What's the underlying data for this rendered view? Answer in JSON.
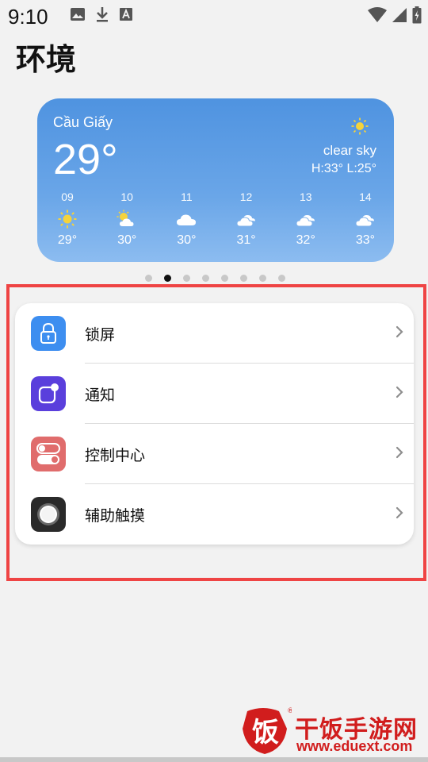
{
  "status_bar": {
    "time": "9:10",
    "left_icons": [
      "image-icon",
      "download-icon",
      "text-icon"
    ],
    "right_icons": [
      "wifi-icon",
      "signal-icon",
      "battery-charging-icon"
    ]
  },
  "page_title": "环境",
  "weather": {
    "city": "Cầu Giấy",
    "temperature": "29°",
    "condition": "clear sky",
    "high_low": "H:33° L:25°",
    "top_icon": "sun-icon",
    "hours": [
      {
        "label": "09",
        "icon": "sun-icon",
        "temp": "29°"
      },
      {
        "label": "10",
        "icon": "partly-sunny-icon",
        "temp": "30°"
      },
      {
        "label": "11",
        "icon": "cloud-icon",
        "temp": "30°"
      },
      {
        "label": "12",
        "icon": "clouds-icon",
        "temp": "31°"
      },
      {
        "label": "13",
        "icon": "clouds-icon",
        "temp": "32°"
      },
      {
        "label": "14",
        "icon": "clouds-icon",
        "temp": "33°"
      }
    ],
    "colors": {
      "top": "#4f93e0",
      "bottom": "#8cbcf0"
    }
  },
  "pager": {
    "count": 8,
    "active_index": 1
  },
  "settings": {
    "items": [
      {
        "label": "锁屏",
        "icon": "lock-icon",
        "icon_color": "#3d8ef0"
      },
      {
        "label": "通知",
        "icon": "notification-icon",
        "icon_color": "#5a3fdc"
      },
      {
        "label": "控制中心",
        "icon": "toggle-icon",
        "icon_color": "#e06c6c"
      },
      {
        "label": "辅助触摸",
        "icon": "assistive-touch-icon",
        "icon_color": "#2a2a2a"
      }
    ]
  },
  "highlight_color": "#ef4444",
  "watermark": {
    "logo_glyph": "饭",
    "title": "干饭手游网",
    "url": "www.eduext.com",
    "registered": "®"
  }
}
